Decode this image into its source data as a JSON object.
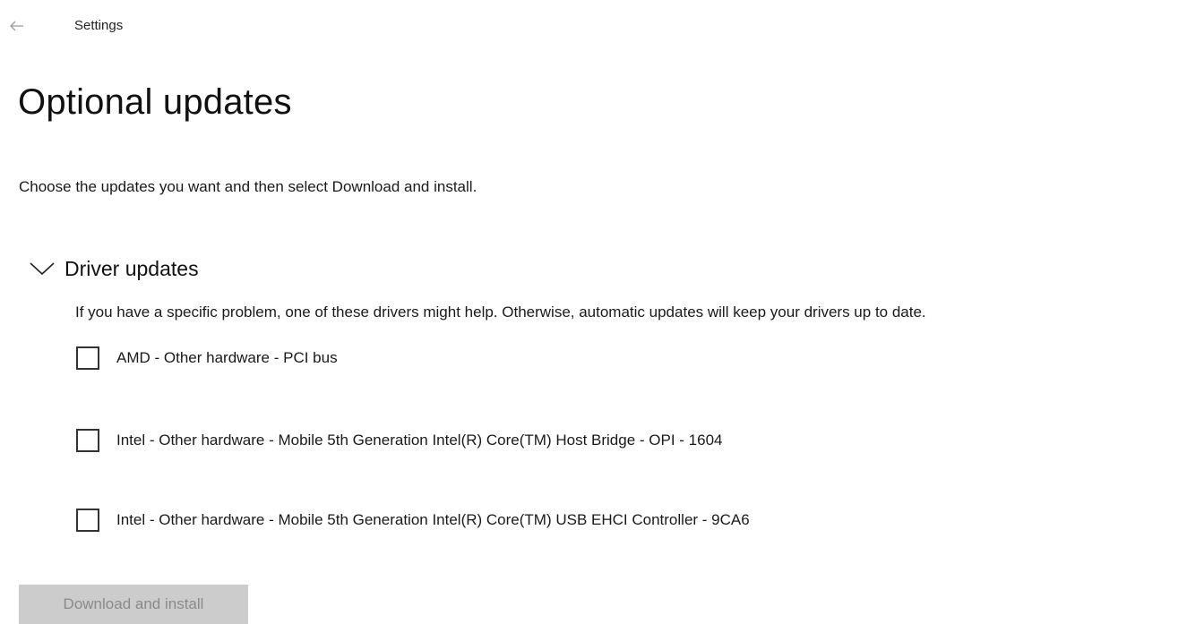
{
  "header": {
    "back_icon": "back-arrow-icon",
    "app_title": "Settings"
  },
  "page": {
    "title": "Optional updates",
    "description": "Choose the updates you want and then select Download and install."
  },
  "driver_section": {
    "chevron_icon": "chevron-down-icon",
    "title": "Driver updates",
    "expanded": true,
    "description": "If you have a specific problem, one of these drivers might help. Otherwise, automatic updates will keep your drivers up to date.",
    "items": [
      {
        "label": "AMD - Other hardware - PCI bus",
        "checked": false
      },
      {
        "label": "Intel - Other hardware - Mobile 5th Generation Intel(R) Core(TM) Host Bridge - OPI - 1604",
        "checked": false
      },
      {
        "label": "Intel - Other hardware - Mobile 5th Generation Intel(R) Core(TM) USB EHCI Controller - 9CA6",
        "checked": false
      }
    ]
  },
  "actions": {
    "download_label": "Download and install",
    "download_enabled": false
  },
  "colors": {
    "background": "#ffffff",
    "button_disabled_bg": "#cccccc",
    "button_disabled_text": "#8a8a8a",
    "text": "#1a1a1a"
  }
}
